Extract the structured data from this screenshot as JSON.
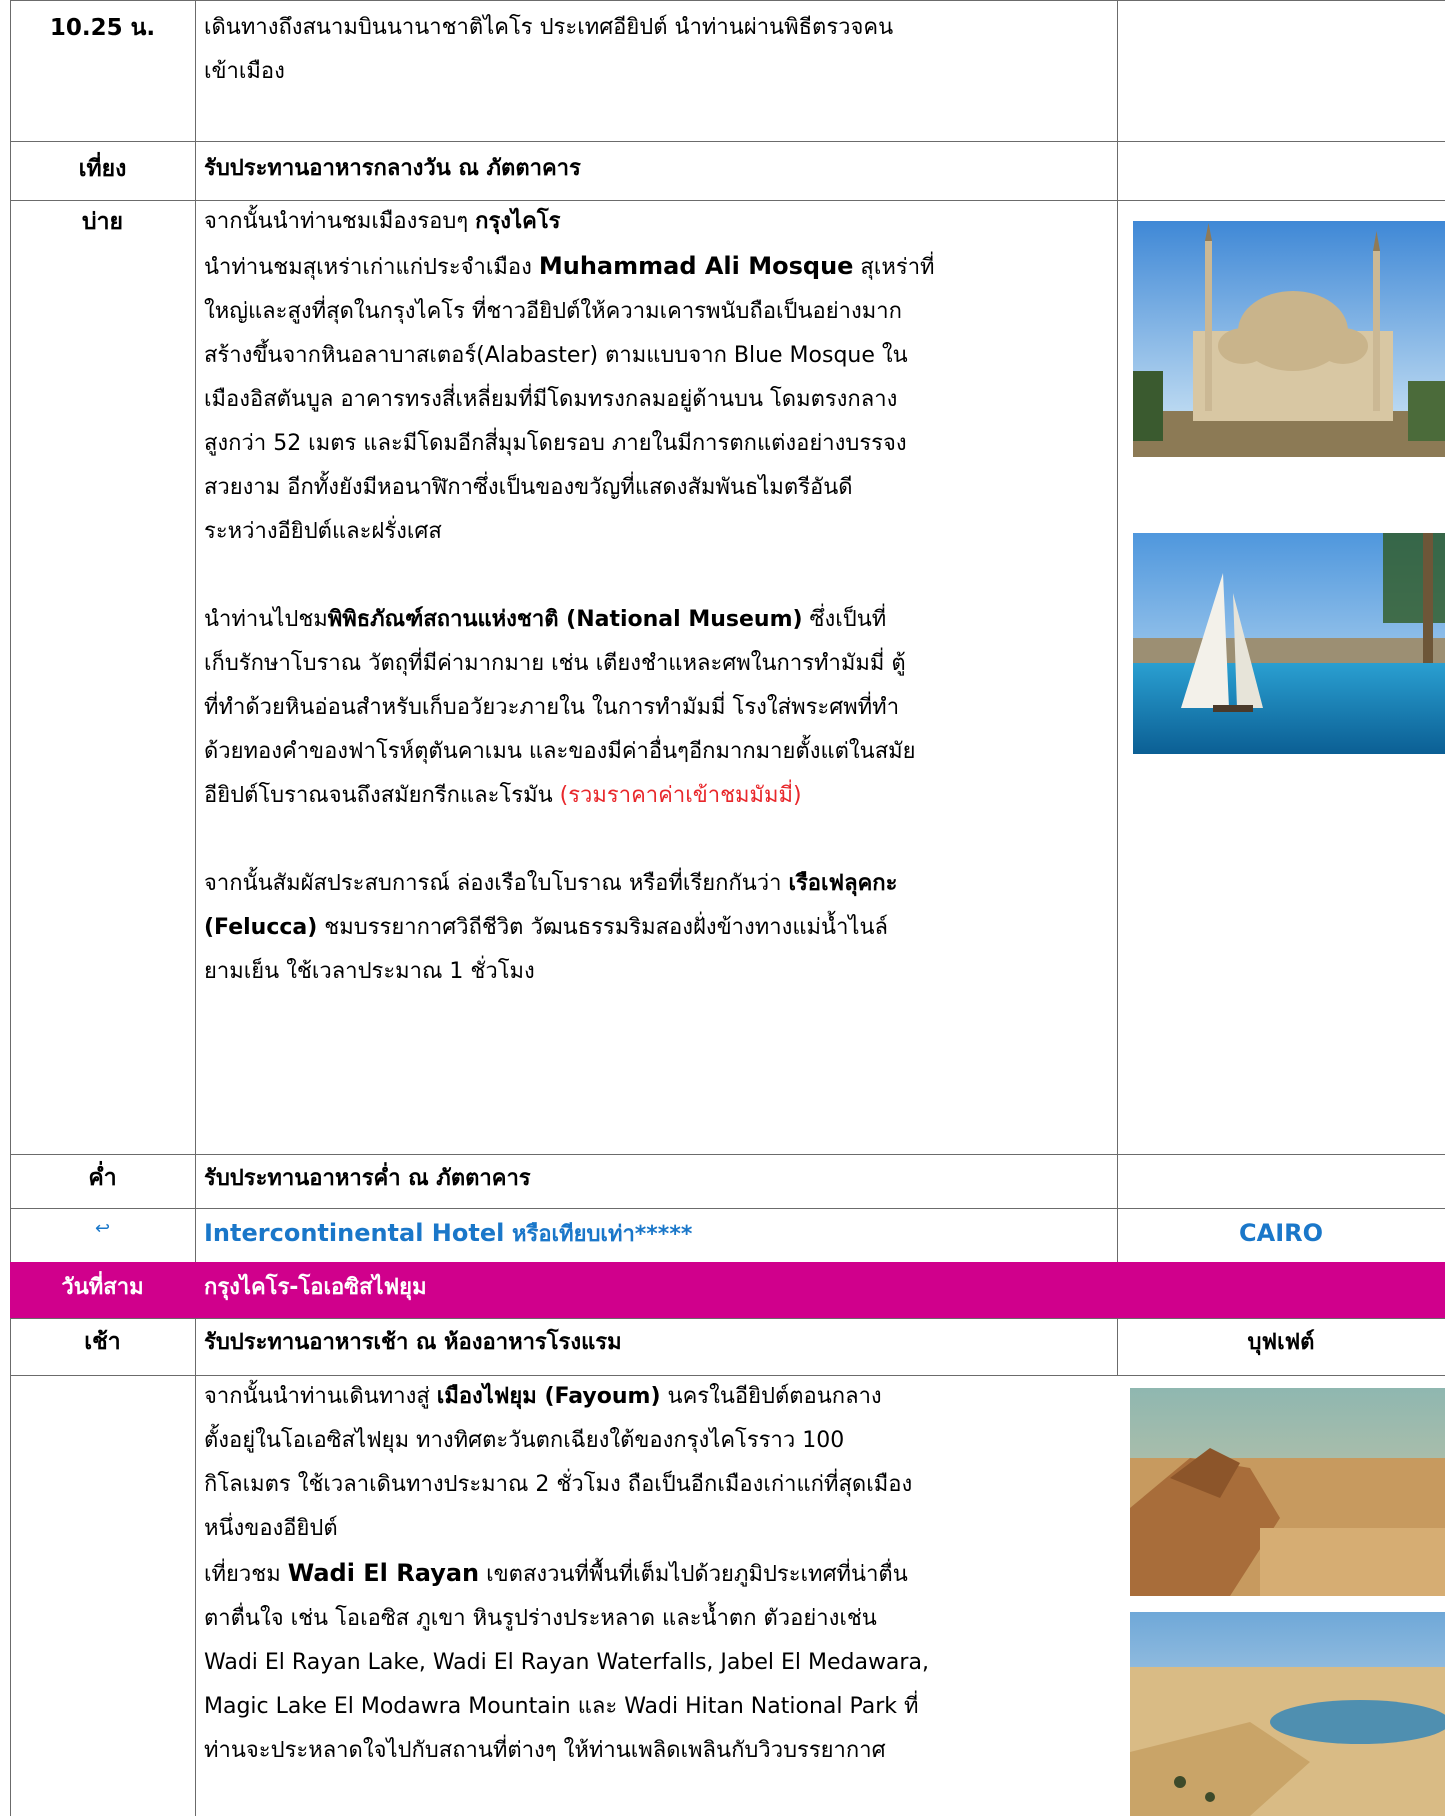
{
  "rows": {
    "r1": {
      "time": "10.25 น.",
      "lines": [
        "เดินทางถึงสนามบินนานาชาติไคโร ประเทศอียิปต์  นำท่านผ่านพิธีตรวจคน",
        "เข้าเมือง"
      ]
    },
    "r2": {
      "time": "เที่ยง",
      "text": "รับประทานอาหารกลางวัน ณ ภัตตาคาร"
    },
    "r3": {
      "time": "บ่าย",
      "intro_a": "จากนั้นนำท่านชมเมืองรอบๆ ",
      "intro_b": "กรุงไคโร",
      "mosque_a": "นำท่านชมสุเหร่าเก่าแก่ประจำเมือง ",
      "mosque_b": "Muhammad Ali Mosque",
      "mosque_c": " สุเหร่าที่",
      "mosque_lines": [
        "ใหญ่และสูงที่สุดในกรุงไคโร ที่ชาวอียิปต์ให้ความเคารพนับถือเป็นอย่างมาก",
        "สร้างขึ้นจากหินอลาบาสเตอร์(Alabaster) ตามแบบจาก Blue Mosque ใน",
        "เมืองอิสตันบูล  อาคารทรงสี่เหลี่ยมที่มีโดมทรงกลมอยู่ด้านบน โดมตรงกลาง",
        "สูงกว่า 52  เมตร และมีโดมอีกสี่มุมโดยรอบ ภายในมีการตกแต่งอย่างบรรจง",
        "สวยงาม อีกทั้งยังมีหอนาฬิกาซึ่งเป็นของขวัญที่แสดงสัมพันธไมตรีอันดี",
        "ระหว่างอียิปต์และฝรั่งเศส"
      ],
      "museum_a": "นำท่านไปชม",
      "museum_b": "พิพิธภัณฑ์สถานแห่งชาติ (National Museum)",
      "museum_c": " ซึ่งเป็นที่",
      "museum_lines": [
        "เก็บรักษาโบราณ วัตถุที่มีค่ามากมาย เช่น เตียงชำแหละศพในการทำมัมมี่ ตู้",
        "ที่ทำด้วยหินอ่อนสำหรับเก็บอวัยวะภายใน ในการทำมัมมี่ โรงใส่พระศพที่ทำ",
        "ด้วยทองคำของฟาโรห์ตุตันคาเมน และของมีค่าอื่นๆอีกมากมายตั้งแต่ในสมัย"
      ],
      "museum_last_a": "อียิปต์โบราณจนถึงสมัยกรีกและโรมัน ",
      "museum_last_red": "(รวมราคาค่าเข้าชมมัมมี่)",
      "felucca_a": "จากนั้นสัมผัสประสบการณ์ ล่องเรือใบโบราณ หรือที่เรียกกันว่า ",
      "felucca_b": "เรือเฟลุคกะ",
      "felucca_c": "(Felucca)",
      "felucca_d": " ชมบรรยากาศวิถีชีวิต วัฒนธรรมริมสองฝั่งข้างทางแม่น้ำไนล์",
      "felucca_e": "ยามเย็น ใช้เวลาประมาณ 1 ชั่วโมง"
    },
    "r4": {
      "time": "ค่ำ",
      "text": "รับประทานอาหารค่ำ ณ ภัตตาคาร"
    },
    "r5": {
      "icon": "hotel-icon",
      "hotel_a": "Intercontinental Hotel",
      "hotel_b": " หรือเทียบเท่า*****",
      "city": "CAIRO"
    },
    "r6": {
      "day": "วันที่สาม",
      "title": "กรุงไคโร-โอเอซิสไฟยุม"
    },
    "r7": {
      "time": "เช้า",
      "text": "รับประทานอาหารเช้า ณ ห้องอาหารโรงแรม",
      "meal": "บุฟเฟต์"
    },
    "r8": {
      "fay_a": "จากนั้นนำท่านเดินทางสู่ ",
      "fay_b": "เมืองไฟยุม (Fayoum)",
      "fay_c": " นครในอียิปต์ตอนกลาง",
      "fay_lines": [
        "ตั้งอยู่ในโอเอซิสไฟยุม ทางทิศตะวันตกเฉียงใต้ของกรุงไคโรราว 100",
        "กิโลเมตร ใช้เวลาเดินทางประมาณ 2 ชั่วโมง ถือเป็นอีกเมืองเก่าแก่ที่สุดเมือง",
        "หนึ่งของอียิปต์"
      ],
      "wadi_a": "เที่ยวชม ",
      "wadi_b": "Wadi El  Rayan",
      "wadi_c": " เขตสงวนที่พื้นที่เต็มไปด้วยภูมิประเทศที่น่าตื่น",
      "wadi_lines": [
        "ตาตื่นใจ เช่น โอเอซิส ภูเขา หินรูปร่างประหลาด และน้ำตก ตัวอย่างเช่น",
        "Wadi El Rayan Lake, Wadi El Rayan Waterfalls, Jabel El Medawara,",
        "Magic Lake El Modawra Mountain และ Wadi Hitan National Park ที่",
        "ท่านจะประหลาดใจไปกับสถานที่ต่างๆ ให้ท่านเพลิดเพลินกับวิวบรรยากาศ"
      ]
    }
  },
  "colors": {
    "pink": "#d0008c",
    "blue": "#1a77c9",
    "red": "#e8272b",
    "border": "#6b6b6b"
  }
}
